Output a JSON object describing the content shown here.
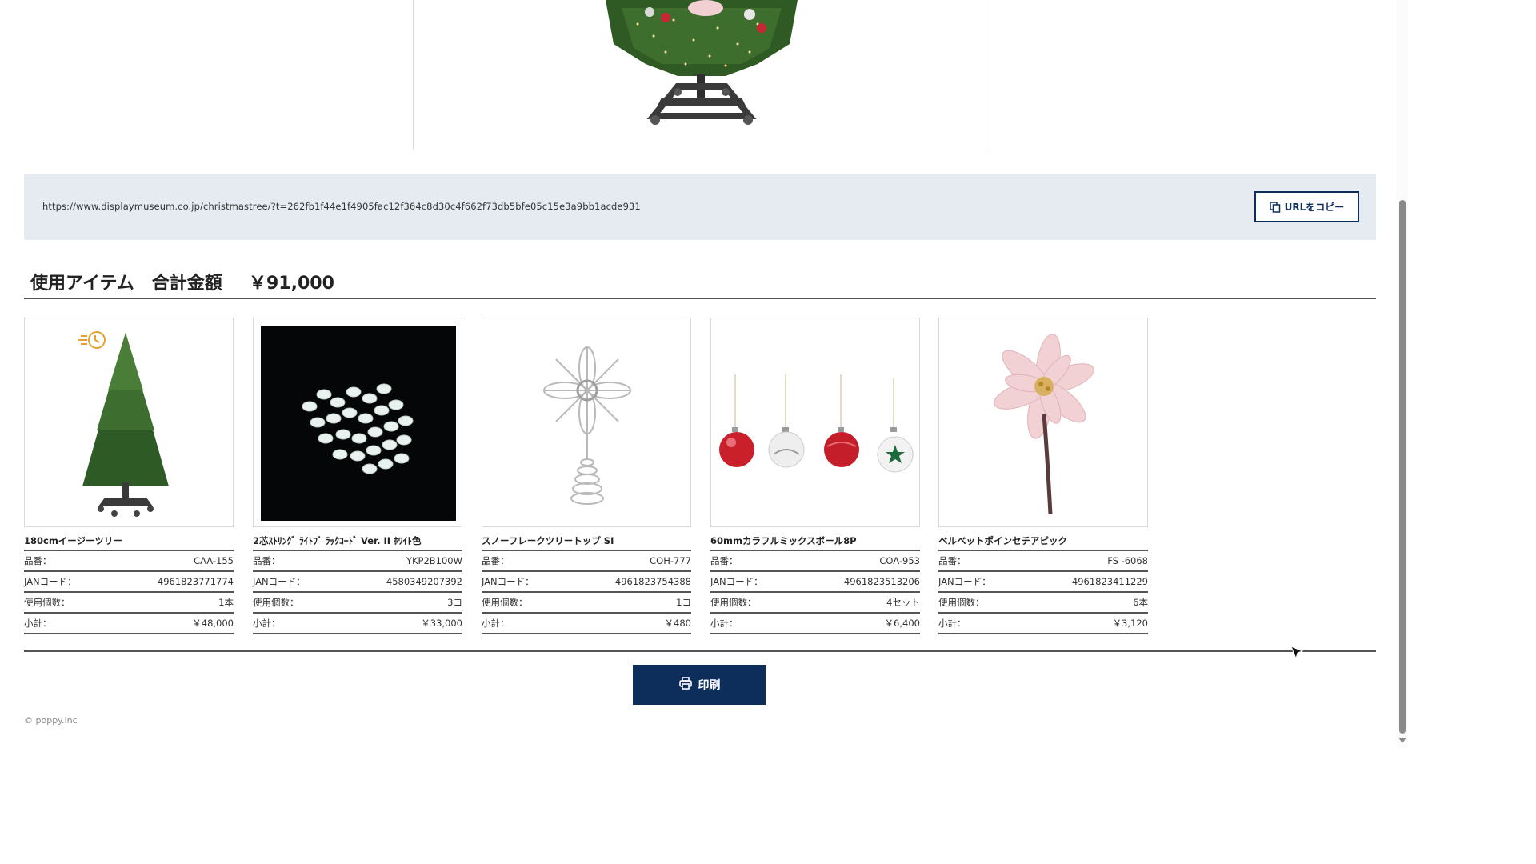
{
  "url_bar": {
    "url": "https://www.displaymuseum.co.jp/christmastree/?t=262fb1f44e1f4905fac12f364c8d30c4f662f73db5bfe05c15e3a9bb1acde931",
    "copy_button_label": "URLをコピー",
    "copy_icon": "copy-icon"
  },
  "summary": {
    "label": "使用アイテム　合計金額",
    "total": "￥91,000"
  },
  "row_labels": {
    "code": "品番：",
    "jan": "JANコード：",
    "qty": "使用個数：",
    "subtotal": "小計："
  },
  "products": [
    {
      "name": "180cmイージーツリー",
      "code": "CAA-155",
      "jan": "4961823771774",
      "qty": "1本",
      "subtotal": "￥48,000",
      "image": "christmas-tree"
    },
    {
      "name": "2芯ｽﾄﾘﾝｸﾞ ﾗｲﾄﾌﾞ ﾗｯｸｺｰﾄﾞ Ver. II ﾎﾜｲﾄ色",
      "code": "YKP2B100W",
      "jan": "4580349207392",
      "qty": "3コ",
      "subtotal": "￥33,000",
      "image": "led-string-lights"
    },
    {
      "name": "スノーフレークツリートップ SI",
      "code": "COH-777",
      "jan": "4961823754388",
      "qty": "1コ",
      "subtotal": "￥480",
      "image": "snowflake-tree-topper"
    },
    {
      "name": "60mmカラフルミックスボール8P",
      "code": "COA-953",
      "jan": "4961823513206",
      "qty": "4セット",
      "subtotal": "￥6,400",
      "image": "ornament-balls"
    },
    {
      "name": "ベルベットポインセチアピック",
      "code": "FS -6068",
      "jan": "4961823411229",
      "qty": "6本",
      "subtotal": "￥3,120",
      "image": "poinsettia-pick"
    }
  ],
  "print_button": {
    "label": "印刷",
    "icon": "printer-icon"
  },
  "footer": {
    "copyright": "© poppy.inc"
  },
  "colors": {
    "navy": "#0d2d5b",
    "url_bg": "#e6eaf1",
    "quick_badge": "#e8a030"
  }
}
